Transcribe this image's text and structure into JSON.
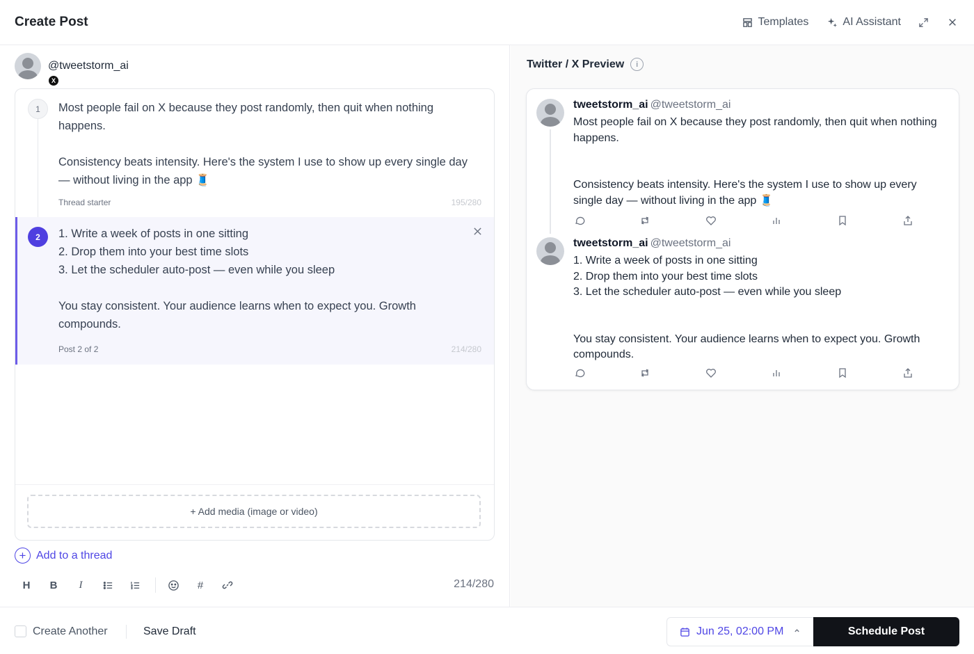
{
  "header": {
    "title": "Create Post",
    "templates_label": "Templates",
    "ai_label": "AI Assistant",
    "expand_icon": "expand-icon",
    "close_icon": "close-icon"
  },
  "composer": {
    "handle": "@tweetstorm_ai",
    "platform_badge": "X",
    "posts": [
      {
        "number": "1",
        "text": "Most people fail on X because they post randomly, then quit when nothing happens.\n\nConsistency beats intensity. Here's the system I use to show up every single day — without living in the app 🧵",
        "meta": "Thread starter",
        "count": "195/280"
      },
      {
        "number": "2",
        "text": "1. Write a week of posts in one sitting\n2. Drop them into your best time slots\n3. Let the scheduler auto-post — even while you sleep\n\nYou stay consistent. Your audience learns when to expect you. Growth compounds.",
        "meta": "Post 2 of 2",
        "count": "214/280"
      }
    ],
    "add_media": "+ Add media (image or video)",
    "add_thread": "Add to a thread",
    "toolbar": {
      "heading": "H",
      "bold": "B",
      "italic": "I",
      "hash": "#"
    },
    "char_count": "214/280"
  },
  "preview": {
    "title": "Twitter / X Preview",
    "tweets": [
      {
        "name": "tweetstorm_ai",
        "handle": "@tweetstorm_ai",
        "text": "Most people fail on X because they post randomly, then quit when nothing happens.\n\n\nConsistency beats intensity. Here's the system I use to show up every single day — without living in the app 🧵"
      },
      {
        "name": "tweetstorm_ai",
        "handle": "@tweetstorm_ai",
        "text": "1. Write a week of posts in one sitting\n2. Drop them into your best time slots\n3. Let the scheduler auto-post — even while you sleep\n\n\nYou stay consistent. Your audience learns when to expect you. Growth compounds."
      }
    ]
  },
  "footer": {
    "create_another": "Create Another",
    "save_draft": "Save Draft",
    "schedule_date": "Jun 25, 02:00 PM",
    "schedule_button": "Schedule Post"
  },
  "colors": {
    "accent": "#4f46e5",
    "selected_post_bg": "#f6f6fd",
    "primary_button": "#111318"
  }
}
